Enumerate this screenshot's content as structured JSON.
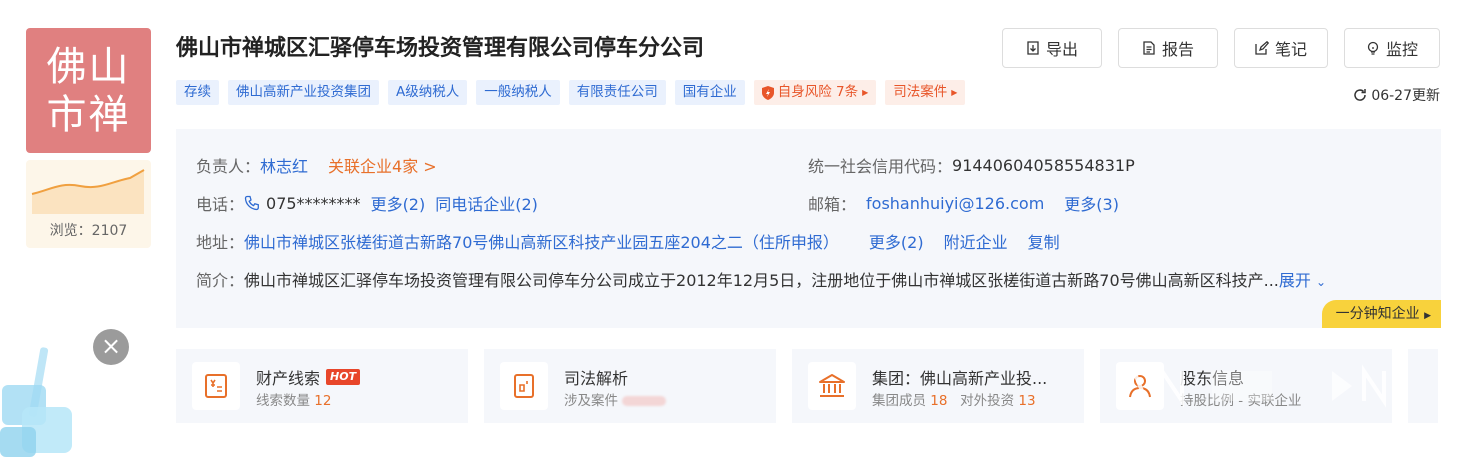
{
  "logo": {
    "line1": "佛山",
    "line2": "市禅"
  },
  "views": {
    "label": "浏览：2107"
  },
  "company": {
    "title": "佛山市禅城区汇驿停车场投资管理有限公司停车分公司"
  },
  "tags": [
    {
      "label": "存续"
    },
    {
      "label": "佛山高新产业投资集团"
    },
    {
      "label": "A级纳税人"
    },
    {
      "label": "一般纳税人"
    },
    {
      "label": "有限责任公司"
    },
    {
      "label": "国有企业"
    }
  ],
  "risk_tag": {
    "label": "自身风险 7条"
  },
  "legal_tag": {
    "label": "司法案件"
  },
  "actions": {
    "export": "导出",
    "report": "报告",
    "notes": "笔记",
    "monitor": "监控"
  },
  "update": {
    "text": "06-27更新"
  },
  "info": {
    "person_label": "负责人：",
    "person_name": "林志红",
    "related": "关联企业4家 >",
    "credit_label": "统一社会信用代码：",
    "credit_code": "91440604058554831P",
    "phone_label": "电话：",
    "phone": "075********",
    "phone_more": "更多(2)",
    "phone_same": "同电话企业(2)",
    "email_label": "邮箱：",
    "email": "foshanhuiyi@126.com",
    "email_more": "更多(3)",
    "address_label": "地址：",
    "address": "佛山市禅城区张槎街道古新路70号佛山高新区科技产业园五座204之二（住所申报）",
    "address_more": "更多(2)",
    "address_nearby": "附近企业",
    "address_copy": "复制",
    "intro_label": "简介：",
    "intro": "佛山市禅城区汇驿停车场投资管理有限公司停车分公司成立于2012年12月5日，注册地位于佛山市禅城区张槎街道古新路70号佛山高新区科技产...",
    "expand": "展开",
    "quick": "一分钟知企业"
  },
  "cards": [
    {
      "name": "财产线索",
      "badge": "HOT",
      "sub_label": "线索数量",
      "sub_value": "12"
    },
    {
      "name": "司法解析",
      "sub_label": "涉及案件"
    },
    {
      "name": "集团：佛山高新产业投...",
      "sub_label": "集团成员",
      "sub_value": "18",
      "sub_label2": "对外投资",
      "sub_value2": "13"
    },
    {
      "name": "股东信息",
      "sub_label": "持股比例",
      "sub_label2": "实联企业"
    }
  ],
  "colors": {
    "brand_blue": "#2f6bd2",
    "accent_orange": "#e8702a",
    "logo_bg": "#e08080",
    "ribbon": "#f8d23c"
  }
}
